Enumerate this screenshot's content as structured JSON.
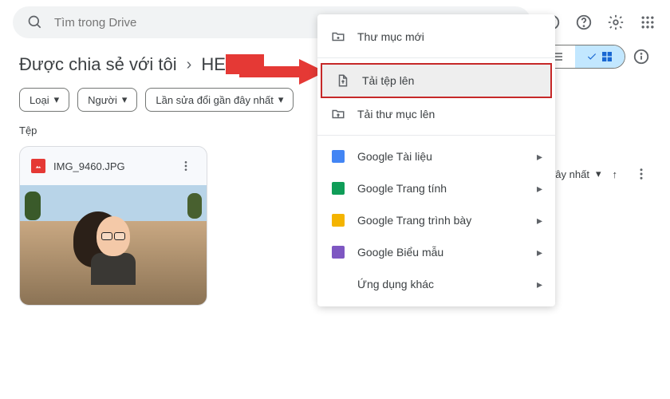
{
  "search": {
    "placeholder": "Tìm trong Drive"
  },
  "breadcrumb": {
    "root": "Được chia sẻ với tôi",
    "folder": "HELLO"
  },
  "filters": {
    "type": "Loại",
    "people": "Người",
    "modified": "Lần sửa đổi gần đây nhất"
  },
  "section_label": "Tệp",
  "sort": {
    "label": "ửa gần đây nhất"
  },
  "file": {
    "name": "IMG_9460.JPG"
  },
  "context_menu": {
    "new_folder": "Thư mục mới",
    "upload_file": "Tải tệp lên",
    "upload_folder": "Tải thư mục lên",
    "google_docs": "Google Tài liệu",
    "google_sheets": "Google Trang tính",
    "google_slides": "Google Trang trình bày",
    "google_forms": "Google Biểu mẫu",
    "more_apps": "Ứng dụng khác"
  },
  "colors": {
    "highlight_border": "#c62828",
    "arrow": "#e53935"
  }
}
